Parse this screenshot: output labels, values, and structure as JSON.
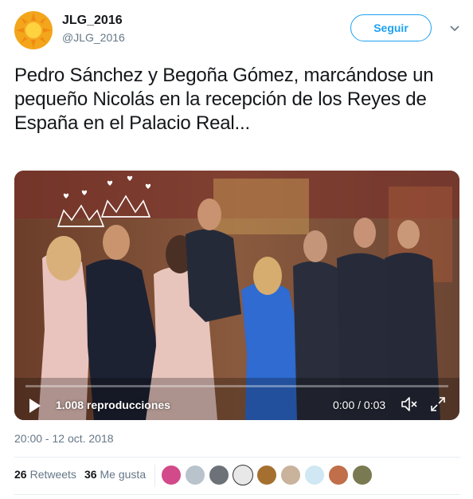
{
  "user": {
    "display_name": "JLG_2016",
    "handle": "@JLG_2016",
    "avatar_icon": "sun-avatar"
  },
  "follow_button": {
    "label": "Seguir"
  },
  "tweet": {
    "text": "Pedro Sánchez y Begoña Gómez, marcándose un pequeño Nicolás en la recepción de los Reyes de España en el Palacio Real..."
  },
  "video": {
    "views": "1.008 reproducciones",
    "time": "0:00 / 0:03",
    "play_icon": "play-icon",
    "volume_icon": "volume-icon",
    "fullscreen_icon": "fullscreen-icon"
  },
  "timestamp": "20:00 - 12 oct. 2018",
  "stats": {
    "retweets_count": "26",
    "retweets_label": "Retweets",
    "likes_count": "36",
    "likes_label": "Me gusta"
  },
  "colors": {
    "accent": "#1da1f2",
    "secondary_text": "#657786",
    "primary_text": "#14171a",
    "divider": "#e6ecf0"
  }
}
